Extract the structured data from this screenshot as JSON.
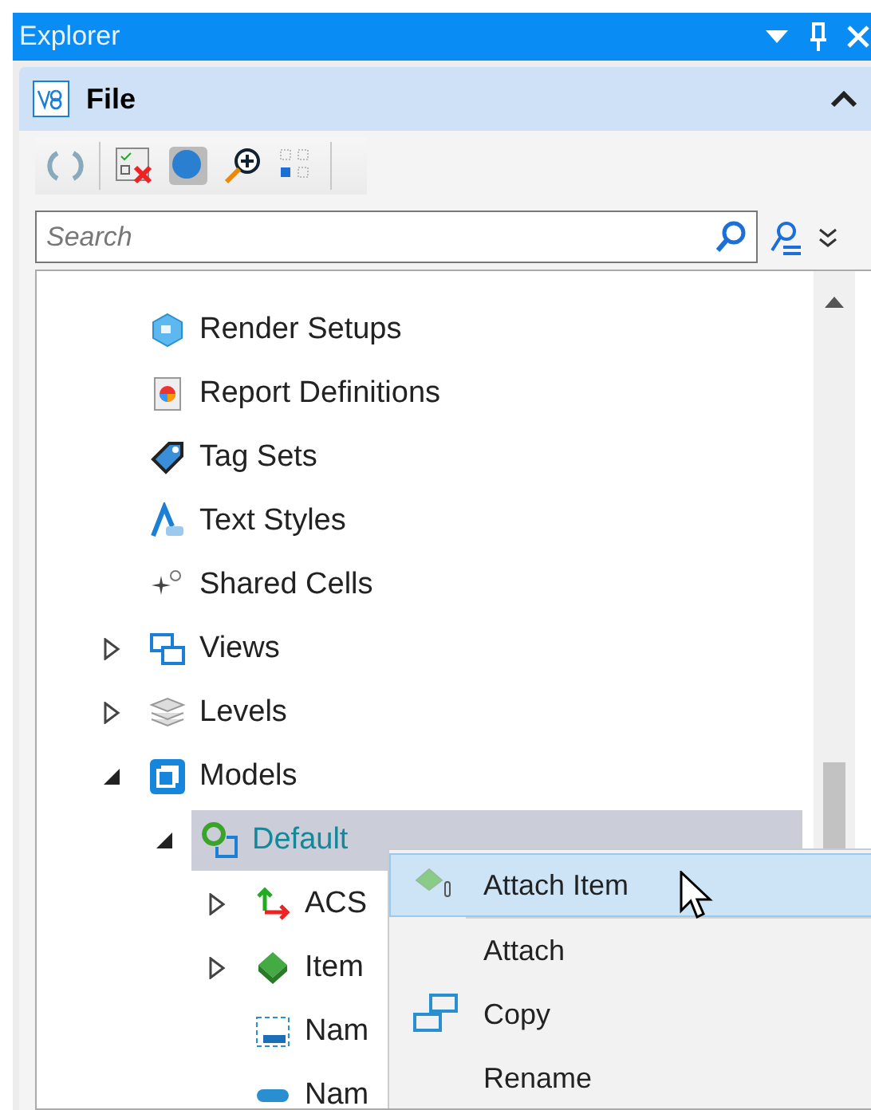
{
  "panel": {
    "title": "Explorer"
  },
  "section": {
    "title": "File",
    "expanded": true
  },
  "search": {
    "placeholder": "Search"
  },
  "tree": [
    {
      "label": "Render Setups",
      "kind": "render",
      "selected": false
    },
    {
      "label": "Report Definitions",
      "kind": "report",
      "selected": false
    },
    {
      "label": "Tag Sets",
      "kind": "tag",
      "selected": false
    },
    {
      "label": "Text Styles",
      "kind": "text",
      "selected": false
    },
    {
      "label": "Shared Cells",
      "kind": "cells",
      "selected": false
    },
    {
      "label": "Views",
      "kind": "views",
      "selected": false,
      "expanded": false
    },
    {
      "label": "Levels",
      "kind": "levels",
      "selected": false,
      "expanded": false
    },
    {
      "label": "Models",
      "kind": "models",
      "selected": false,
      "expanded": true,
      "children": [
        {
          "label": "Default",
          "kind": "model",
          "selected": true,
          "expanded": true,
          "children": [
            {
              "label": "ACS",
              "kind": "acs",
              "selected": false,
              "expanded": false
            },
            {
              "label": "Item",
              "kind": "item",
              "selected": false,
              "expanded": false
            },
            {
              "label": "Nam",
              "kind": "named",
              "selected": false
            },
            {
              "label": "Nam",
              "kind": "group",
              "selected": false
            }
          ]
        }
      ]
    }
  ],
  "context_menu": [
    {
      "label": "Attach Item",
      "kind": "attach-item",
      "selected": true
    },
    {
      "label": "Attach",
      "kind": "plain",
      "selected": false
    },
    {
      "label": "Copy",
      "kind": "copy",
      "selected": false
    },
    {
      "label": "Rename",
      "kind": "plain",
      "selected": false
    }
  ]
}
